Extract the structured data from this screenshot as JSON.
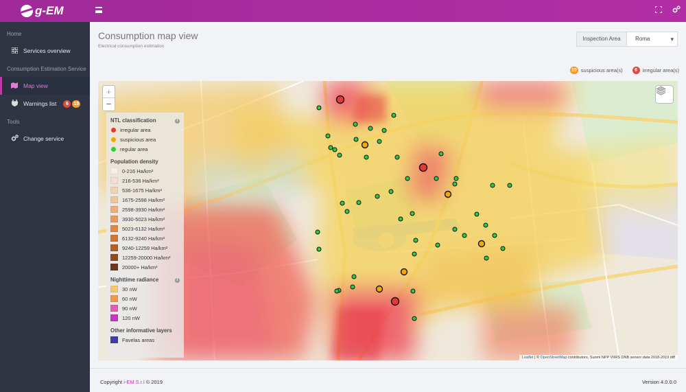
{
  "app": {
    "logo_text": "g-EM"
  },
  "sidebar": {
    "sections": [
      {
        "label": "Home"
      },
      {
        "label": "Consumption Estimation Service"
      },
      {
        "label": "Tools"
      }
    ],
    "items": [
      {
        "label": "Services overview",
        "icon": "grid-icon"
      },
      {
        "label": "Map view",
        "icon": "map-icon",
        "active": true
      },
      {
        "label": "Warnings list",
        "icon": "plug-icon",
        "badge_red": "6",
        "badge_orange": "19"
      },
      {
        "label": "Change service",
        "icon": "cogs-icon"
      }
    ]
  },
  "header": {
    "title": "Consumption map view",
    "subtitle": "Electrical consumption estimation",
    "area_label": "Inspection Area",
    "area_value": "Roma"
  },
  "counters": {
    "suspicious_count": "19",
    "suspicious_label": "suspicious area(s)",
    "irregular_count": "6",
    "irregular_label": "irregular area(s)"
  },
  "map": {
    "zoom_in": "+",
    "zoom_out": "−",
    "attribution_leaflet": "Leaflet",
    "attribution_sep": " | © ",
    "attribution_osm": "OpenStreetMap",
    "attribution_rest": " contributors, Suomi NPP VIIRS DNB sensor data 2018-2019 diff"
  },
  "legend": {
    "ntl_title": "NTL classification",
    "ntl_items": [
      {
        "label": "irregular area",
        "color": "#e53935"
      },
      {
        "label": "suspicious area",
        "color": "#f2a900"
      },
      {
        "label": "regular area",
        "color": "#2ecc40"
      }
    ],
    "pop_title": "Population density",
    "pop_items": [
      {
        "label": "0-216 Ha/km²",
        "color": "#f4efe9"
      },
      {
        "label": "216-536 Ha/km²",
        "color": "#f1e0cf"
      },
      {
        "label": "536-1675 Ha/km²",
        "color": "#efd3b6"
      },
      {
        "label": "1675-2598 Ha/km²",
        "color": "#edc59b"
      },
      {
        "label": "2598-3930 Ha/km²",
        "color": "#e9b07c"
      },
      {
        "label": "3930-5023 Ha/km²",
        "color": "#e59c5e"
      },
      {
        "label": "5023-6132 Ha/km²",
        "color": "#de8846"
      },
      {
        "label": "6132-9240 Ha/km²",
        "color": "#d07634"
      },
      {
        "label": "9240-12259 Ha/km²",
        "color": "#b3602a"
      },
      {
        "label": "12259-20000 Ha/km²",
        "color": "#934c22"
      },
      {
        "label": "20000+ Ha/km²",
        "color": "#6f381b"
      }
    ],
    "rad_title": "Nighttime radiance",
    "rad_items": [
      {
        "label": "30 nW",
        "color": "#f3c86a"
      },
      {
        "label": "60 nW",
        "color": "#ef9a4a"
      },
      {
        "label": "90 nW",
        "color": "#e05fb0"
      },
      {
        "label": "120 nW",
        "color": "#c837c2"
      }
    ],
    "other_title": "Other informative layers",
    "other_items": [
      {
        "label": "Favelas areas",
        "color": "#3f3fa3"
      }
    ]
  },
  "footer": {
    "copyright_prefix": "Copyright ",
    "company": "i-EM S.r.l",
    "copyright_suffix": " © 2019",
    "version": "Version 4.0.0.0"
  },
  "colors": {
    "brand": "#b12ea3",
    "sidebar": "#2f3542",
    "irregular": "#e53935",
    "suspicious": "#f2a900",
    "regular": "#2ecc40"
  }
}
